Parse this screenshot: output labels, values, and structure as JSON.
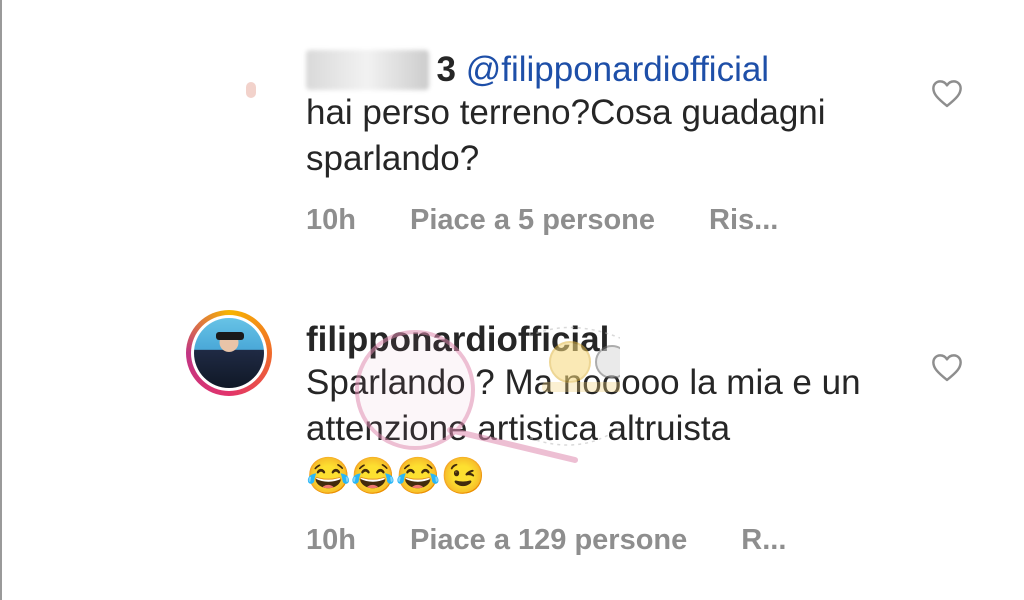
{
  "comments": [
    {
      "username_redacted": "c3",
      "username_visible_suffix": "3",
      "mention": "@filipponardiofficial",
      "text": "hai perso terreno?Cosa guadagni sparlando?",
      "time": "10h",
      "likes": "Piace a 5 persone",
      "reply": "Ris..."
    },
    {
      "username": "filipponardiofficial",
      "text": "Sparlando ? Ma nooooo la mia e un attenzione artistica altruista",
      "emoji": "😂😂😂😉",
      "time": "10h",
      "likes": "Piace a 129 persone",
      "reply": "R..."
    }
  ],
  "icons": {
    "like": "heart-outline-icon"
  },
  "colors": {
    "text": "#262626",
    "meta": "#8e8e8e",
    "mention": "#1e4fa8"
  }
}
